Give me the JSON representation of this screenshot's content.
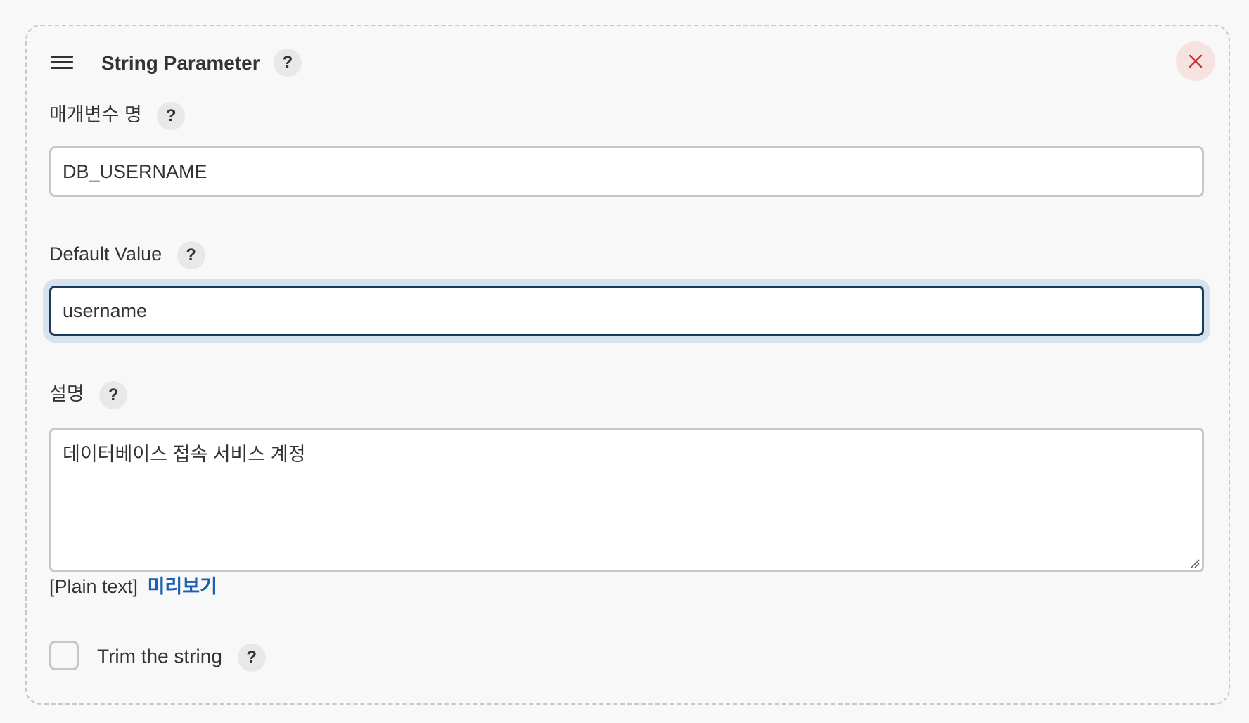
{
  "section": {
    "title": "String Parameter",
    "help_glyph": "?",
    "close_glyph": "×"
  },
  "fields": {
    "name": {
      "label": "매개변수 명",
      "value": "DB_USERNAME"
    },
    "default_value": {
      "label": "Default Value",
      "value": "username"
    },
    "description": {
      "label": "설명",
      "value": "데이터베이스 접속 서비스 계정"
    }
  },
  "markup": {
    "format": "[Plain text]",
    "preview_link": "미리보기"
  },
  "trim": {
    "label": "Trim the string",
    "checked": false
  },
  "colors": {
    "accent_link": "#1a5fb4",
    "focus_border": "#1c3a5b",
    "close_icon": "#d32f2f",
    "close_bg": "#f7e2e2"
  },
  "icons": [
    "drag-handle-icon",
    "help-icon",
    "close-icon",
    "resize-grip-icon"
  ]
}
